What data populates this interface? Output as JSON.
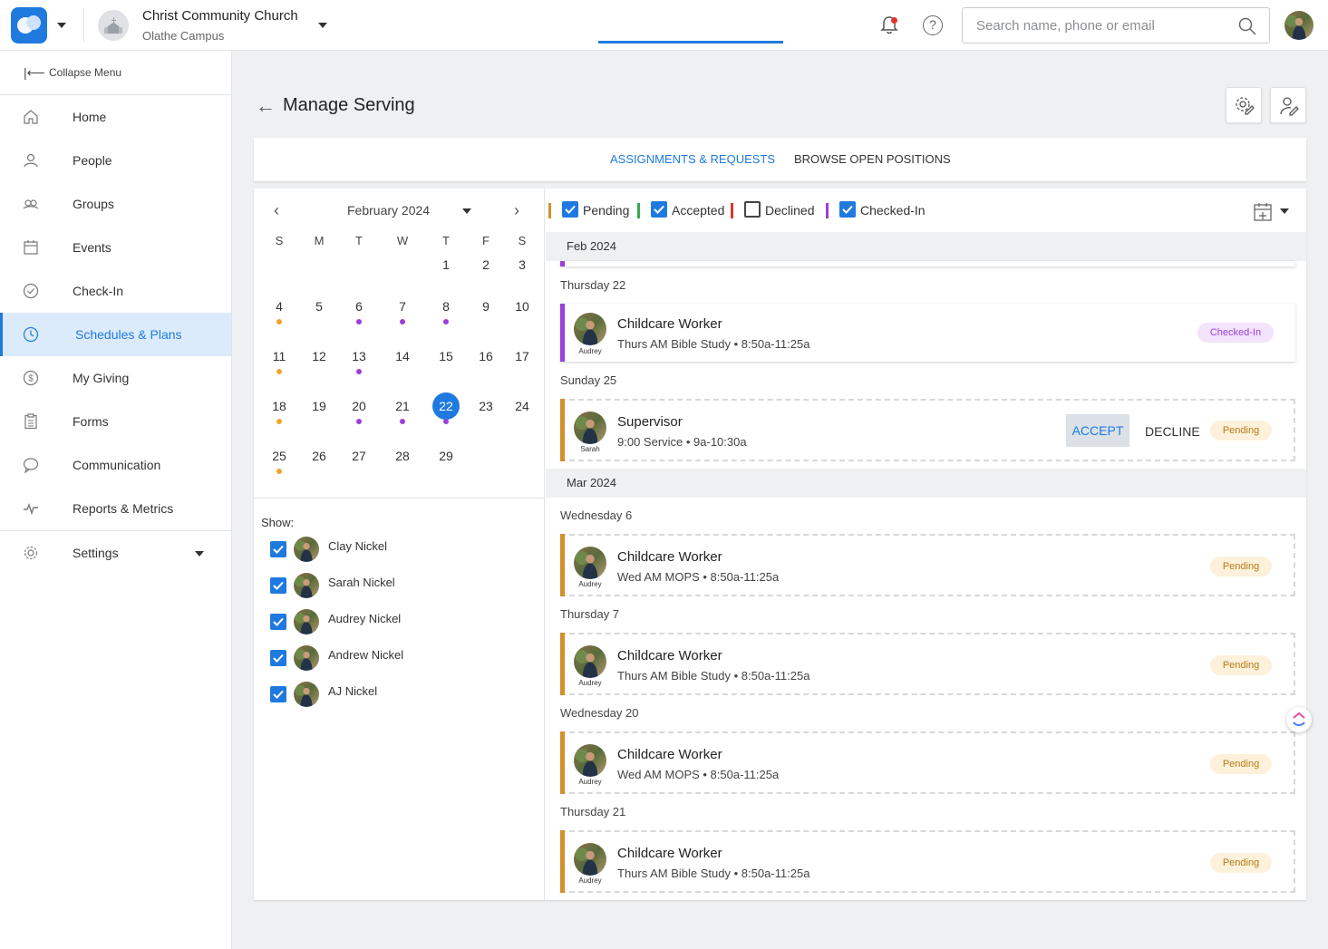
{
  "header": {
    "church_name": "Christ Community Church",
    "campus": "Olathe Campus",
    "search_placeholder": "Search name, phone or email",
    "help_glyph": "?",
    "icons": [
      "app-logo-icon",
      "church-icon",
      "bell-icon",
      "help-icon",
      "search-icon",
      "user-avatar"
    ]
  },
  "sidebar": {
    "collapse_label": "Collapse Menu",
    "items": [
      {
        "label": "Home",
        "icon": "home-icon"
      },
      {
        "label": "People",
        "icon": "people-icon"
      },
      {
        "label": "Groups",
        "icon": "groups-icon"
      },
      {
        "label": "Events",
        "icon": "calendar-icon"
      },
      {
        "label": "Check-In",
        "icon": "check-circle-icon"
      },
      {
        "label": "Schedules & Plans",
        "icon": "clock-icon",
        "active": true
      },
      {
        "label": "My Giving",
        "icon": "dollar-icon"
      },
      {
        "label": "Forms",
        "icon": "clipboard-icon"
      },
      {
        "label": "Communication",
        "icon": "chat-icon"
      },
      {
        "label": "Reports & Metrics",
        "icon": "activity-icon"
      },
      {
        "label": "Settings",
        "icon": "gear-icon"
      }
    ]
  },
  "page": {
    "title": "Manage Serving",
    "tabs": [
      "ASSIGNMENTS & REQUESTS",
      "BROWSE OPEN POSITIONS"
    ],
    "active_tab": 0
  },
  "calendar": {
    "month_label": "February 2024",
    "weekdays": [
      "S",
      "M",
      "T",
      "W",
      "T",
      "F",
      "S"
    ],
    "weeks": [
      [
        "",
        "",
        "",
        "",
        "1",
        "2",
        "3"
      ],
      [
        "4",
        "5",
        "6",
        "7",
        "8",
        "9",
        "10"
      ],
      [
        "11",
        "12",
        "13",
        "14",
        "15",
        "16",
        "17"
      ],
      [
        "18",
        "19",
        "20",
        "21",
        "22",
        "23",
        "24"
      ],
      [
        "25",
        "26",
        "27",
        "28",
        "29",
        "",
        ""
      ]
    ],
    "selected_day": "22",
    "dots": {
      "4": "orange",
      "6": "purple",
      "7": "purple",
      "8": "purple",
      "11": "orange",
      "13": "purple",
      "18": "orange",
      "20": "purple",
      "21": "purple",
      "22": "purple",
      "25": "orange"
    }
  },
  "show": {
    "label": "Show:",
    "people": [
      "Clay Nickel",
      "Sarah Nickel",
      "Audrey Nickel",
      "Andrew Nickel",
      "AJ Nickel"
    ]
  },
  "filters": [
    {
      "label": "Pending",
      "checked": true,
      "color": "#d4902a"
    },
    {
      "label": "Accepted",
      "checked": true,
      "color": "#3aa655"
    },
    {
      "label": "Declined",
      "checked": false,
      "color": "#d93a2b"
    },
    {
      "label": "Checked-In",
      "checked": true,
      "color": "#9b3fd8"
    }
  ],
  "colors": {
    "accent": "#1f7ae0",
    "pending": "#d4902a",
    "checked_in": "#9b3fd8"
  },
  "feed": {
    "months": [
      "Feb 2024",
      "Mar 2024"
    ],
    "days": [
      "Thursday 22",
      "Sunday 25",
      "Wednesday 6",
      "Thursday 7",
      "Wednesday 20",
      "Thursday 21"
    ],
    "cards": [
      {
        "title": "Childcare Worker",
        "subtitle": "Thurs AM Bible Study • 8:50a-11:25a",
        "person": "Audrey",
        "status": "Checked-In"
      },
      {
        "title": "Supervisor",
        "subtitle": "9:00 Service • 9a-10:30a",
        "person": "Sarah",
        "status": "Pending",
        "accept": "ACCEPT",
        "decline": "DECLINE"
      },
      {
        "title": "Childcare Worker",
        "subtitle": "Wed AM MOPS • 8:50a-11:25a",
        "person": "Audrey",
        "status": "Pending"
      },
      {
        "title": "Childcare Worker",
        "subtitle": "Thurs AM Bible Study • 8:50a-11:25a",
        "person": "Audrey",
        "status": "Pending"
      },
      {
        "title": "Childcare Worker",
        "subtitle": "Wed AM MOPS • 8:50a-11:25a",
        "person": "Audrey",
        "status": "Pending"
      },
      {
        "title": "Childcare Worker",
        "subtitle": "Thurs AM Bible Study • 8:50a-11:25a",
        "person": "Audrey",
        "status": "Pending"
      }
    ]
  }
}
